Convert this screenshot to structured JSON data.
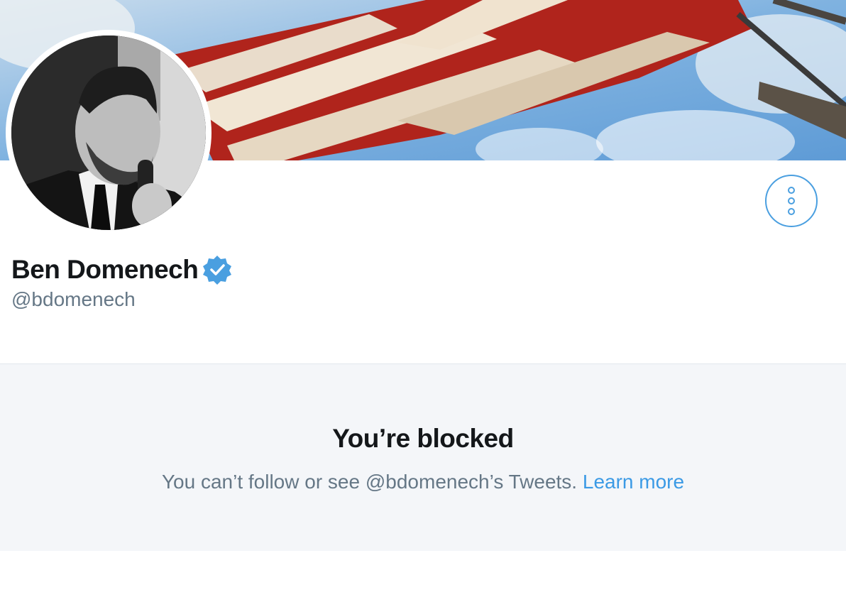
{
  "profile": {
    "display_name": "Ben Domenech",
    "handle": "@bdomenech",
    "verified": true
  },
  "icons": {
    "verified": "verified-badge-icon",
    "more": "more-options-icon"
  },
  "blocked": {
    "title": "You’re blocked",
    "message": "You can’t follow or see @bdomenech’s Tweets.",
    "link_text": "Learn more"
  },
  "colors": {
    "accent": "#3b9ae5",
    "verified": "#4a9fe0",
    "text_primary": "#14171a",
    "text_secondary": "#657786",
    "panel_background": "#f4f6f9"
  }
}
